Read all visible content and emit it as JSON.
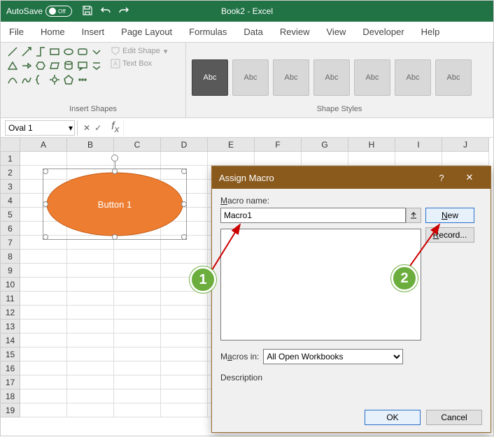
{
  "titlebar": {
    "autosave_label": "AutoSave",
    "autosave_state": "Off",
    "app_title": "Book2 - Excel"
  },
  "tabs": [
    "File",
    "Home",
    "Insert",
    "Page Layout",
    "Formulas",
    "Data",
    "Review",
    "View",
    "Developer",
    "Help"
  ],
  "ribbon": {
    "insert_shapes_label": "Insert Shapes",
    "edit_shape_label": "Edit Shape",
    "text_box_label": "Text Box",
    "shape_styles_label": "Shape Styles",
    "style_swatch_text": "Abc"
  },
  "name_box": "Oval 1",
  "columns": [
    "A",
    "B",
    "C",
    "D",
    "E",
    "F",
    "G",
    "H",
    "I",
    "J"
  ],
  "rows": [
    "1",
    "2",
    "3",
    "4",
    "5",
    "6",
    "7",
    "8",
    "9",
    "10",
    "11",
    "12",
    "13",
    "14",
    "15",
    "16",
    "17",
    "18",
    "19"
  ],
  "shape_label": "Button 1",
  "dialog": {
    "title": "Assign Macro",
    "help_icon": "?",
    "close_icon": "✕",
    "macro_name_label": "Macro name:",
    "macro_name_value": "Macro1",
    "new_btn": "New",
    "record_btn": "Record...",
    "macros_in_label": "Macros in:",
    "macros_in_value": "All Open Workbooks",
    "description_label": "Description",
    "ok_btn": "OK",
    "cancel_btn": "Cancel"
  },
  "badges": {
    "one": "1",
    "two": "2"
  }
}
